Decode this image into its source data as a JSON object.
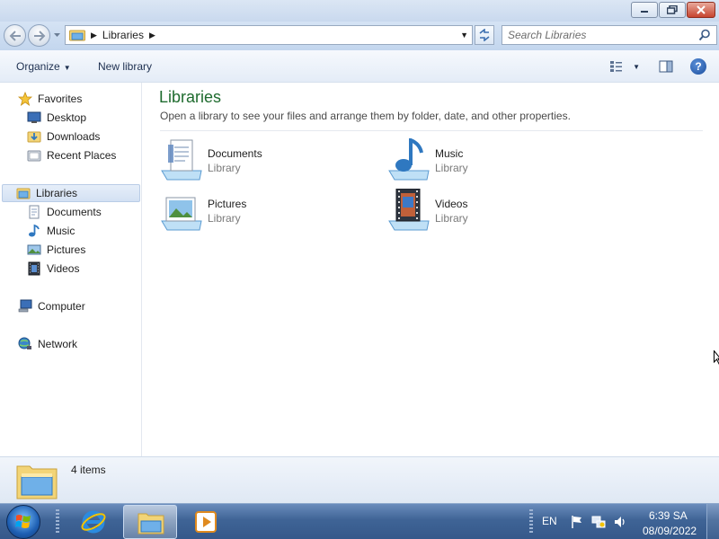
{
  "window": {
    "controls": {
      "minimize": "minimize",
      "maximize": "maximize",
      "close": "close"
    }
  },
  "address_bar": {
    "path": "Libraries",
    "search_placeholder": "Search Libraries"
  },
  "command_bar": {
    "organize": "Organize",
    "new_library": "New library"
  },
  "nav_pane": {
    "favorites": {
      "label": "Favorites",
      "items": [
        {
          "label": "Desktop",
          "icon": "desktop-icon"
        },
        {
          "label": "Downloads",
          "icon": "downloads-icon"
        },
        {
          "label": "Recent Places",
          "icon": "recent-places-icon"
        }
      ]
    },
    "libraries": {
      "label": "Libraries",
      "selected": true,
      "items": [
        {
          "label": "Documents",
          "icon": "documents-icon"
        },
        {
          "label": "Music",
          "icon": "music-icon"
        },
        {
          "label": "Pictures",
          "icon": "pictures-icon"
        },
        {
          "label": "Videos",
          "icon": "videos-icon"
        }
      ]
    },
    "computer": {
      "label": "Computer"
    },
    "network": {
      "label": "Network"
    }
  },
  "content": {
    "title": "Libraries",
    "subtitle": "Open a library to see your files and arrange them by folder, date, and other properties.",
    "items": [
      {
        "name": "Documents",
        "type": "Library",
        "icon": "documents-library-icon"
      },
      {
        "name": "Music",
        "type": "Library",
        "icon": "music-library-icon"
      },
      {
        "name": "Pictures",
        "type": "Library",
        "icon": "pictures-library-icon"
      },
      {
        "name": "Videos",
        "type": "Library",
        "icon": "videos-library-icon"
      }
    ]
  },
  "details": {
    "count": "4 items"
  },
  "taskbar": {
    "language": "EN",
    "time": "6:39 SA",
    "date": "08/09/2022",
    "colors": {
      "accent": "#3f6496",
      "title_green": "#1e6b2e"
    }
  }
}
